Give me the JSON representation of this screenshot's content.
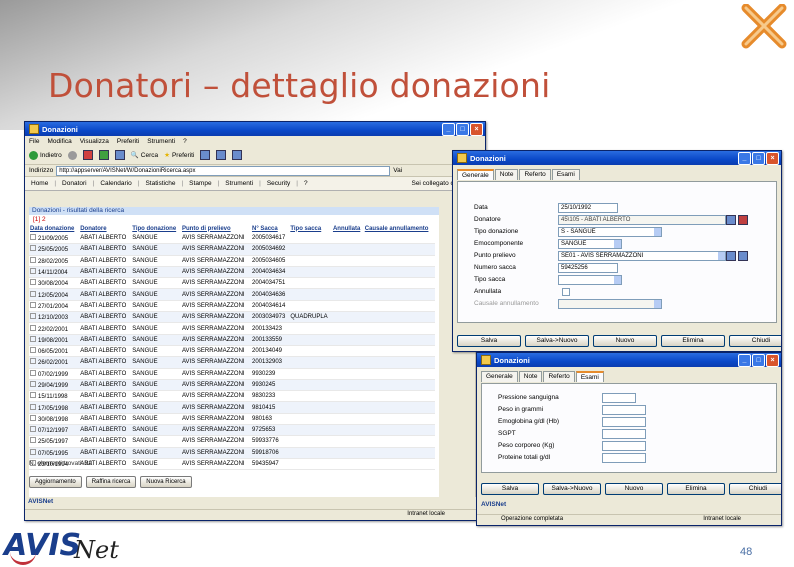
{
  "slide": {
    "title": "Donatori – dettaglio donazioni",
    "page_number": "48",
    "footer_logo_a": "AVIS",
    "footer_logo_net": "Net"
  },
  "browser": {
    "title": "Donazioni",
    "menu": [
      "File",
      "Modifica",
      "Visualizza",
      "Preferiti",
      "Strumenti",
      "?"
    ],
    "toolbar": [
      "Indietro",
      "Cerca",
      "Preferiti"
    ],
    "address_label": "Indirizzo",
    "address": "http://appserver/AVISNet/W/DonazioniRicerca.aspx",
    "go_label": "Vai",
    "app_tabs": [
      "Home",
      "Donatori",
      "Calendario",
      "Statistiche",
      "Stampe",
      "Strumenti",
      "Security",
      "?"
    ],
    "connected": "Sei collegato con",
    "search_title": "Donazioni - risultati della ricerca",
    "pager": "[1] 2",
    "columns": [
      "Data donazione",
      "Donatore",
      "Tipo donazione",
      "Punto di prelievo",
      "N° Sacca",
      "Tipo sacca",
      "Annullata",
      "Causale annullamento"
    ],
    "rows": [
      [
        "21/09/2005",
        "ABATI ALBERTO",
        "SANGUE",
        "AVIS SERRAMAZZONI",
        "2005034617",
        "",
        "",
        ""
      ],
      [
        "25/05/2005",
        "ABATI ALBERTO",
        "SANGUE",
        "AVIS SERRAMAZZONI",
        "2005034692",
        "",
        "",
        ""
      ],
      [
        "28/02/2005",
        "ABATI ALBERTO",
        "SANGUE",
        "AVIS SERRAMAZZONI",
        "2005034605",
        "",
        "",
        ""
      ],
      [
        "14/11/2004",
        "ABATI ALBERTO",
        "SANGUE",
        "AVIS SERRAMAZZONI",
        "2004034634",
        "",
        "",
        ""
      ],
      [
        "30/08/2004",
        "ABATI ALBERTO",
        "SANGUE",
        "AVIS SERRAMAZZONI",
        "2004034751",
        "",
        "",
        ""
      ],
      [
        "12/05/2004",
        "ABATI ALBERTO",
        "SANGUE",
        "AVIS SERRAMAZZONI",
        "2004034636",
        "",
        "",
        ""
      ],
      [
        "27/01/2004",
        "ABATI ALBERTO",
        "SANGUE",
        "AVIS SERRAMAZZONI",
        "2004034614",
        "",
        "",
        ""
      ],
      [
        "12/10/2003",
        "ABATI ALBERTO",
        "SANGUE",
        "AVIS SERRAMAZZONI",
        "2003034973",
        "QUADRUPLA",
        "",
        ""
      ],
      [
        "22/02/2001",
        "ABATI ALBERTO",
        "SANGUE",
        "AVIS SERRAMAZZONI",
        "200133423",
        "",
        "",
        ""
      ],
      [
        "19/08/2001",
        "ABATI ALBERTO",
        "SANGUE",
        "AVIS SERRAMAZZONI",
        "200133559",
        "",
        "",
        ""
      ],
      [
        "06/05/2001",
        "ABATI ALBERTO",
        "SANGUE",
        "AVIS SERRAMAZZONI",
        "200134049",
        "",
        "",
        ""
      ],
      [
        "26/02/2001",
        "ABATI ALBERTO",
        "SANGUE",
        "AVIS SERRAMAZZONI",
        "200132903",
        "",
        "",
        ""
      ],
      [
        "07/02/1999",
        "ABATI ALBERTO",
        "SANGUE",
        "AVIS SERRAMAZZONI",
        "9930239",
        "",
        "",
        ""
      ],
      [
        "29/04/1999",
        "ABATI ALBERTO",
        "SANGUE",
        "AVIS SERRAMAZZONI",
        "9930245",
        "",
        "",
        ""
      ],
      [
        "15/11/1998",
        "ABATI ALBERTO",
        "SANGUE",
        "AVIS SERRAMAZZONI",
        "9830233",
        "",
        "",
        ""
      ],
      [
        "17/05/1998",
        "ABATI ALBERTO",
        "SANGUE",
        "AVIS SERRAMAZZONI",
        "9810415",
        "",
        "",
        ""
      ],
      [
        "30/08/1998",
        "ABATI ALBERTO",
        "SANGUE",
        "AVIS SERRAMAZZONI",
        "980163",
        "",
        "",
        ""
      ],
      [
        "07/12/1997",
        "ABATI ALBERTO",
        "SANGUE",
        "AVIS SERRAMAZZONI",
        "9725653",
        "",
        "",
        ""
      ],
      [
        "25/05/1997",
        "ABATI ALBERTO",
        "SANGUE",
        "AVIS SERRAMAZZONI",
        "59933776",
        "",
        "",
        ""
      ],
      [
        "07/05/1995",
        "ABATI ALBERTO",
        "SANGUE",
        "AVIS SERRAMAZZONI",
        "59918706",
        "",
        "",
        ""
      ],
      [
        "23/10/1994",
        "ABATI ALBERTO",
        "SANGUE",
        "AVIS SERRAMAZZONI",
        "59435947",
        "",
        "",
        ""
      ]
    ],
    "found": "N. elementi trovati: 22",
    "buttons": [
      "Aggiornamento",
      "Raffina ricerca",
      "Nuova Ricerca"
    ],
    "app_label": "AVISNet",
    "status_zone": "Intranet locale"
  },
  "dialog1": {
    "title": "Donazioni",
    "tabs": [
      "Generale",
      "Note",
      "Referto",
      "Esami"
    ],
    "fields": [
      {
        "label": "Data",
        "value": "25/10/1992"
      },
      {
        "label": "Donatore",
        "value": "45\\105 - ABATI ALBERTO"
      },
      {
        "label": "Tipo donazione",
        "value": "S - SANGUE"
      },
      {
        "label": "Emocomponente",
        "value": "SANGUE"
      },
      {
        "label": "Punto prelievo",
        "value": "SE01 - AVIS SERRAMAZZONI"
      },
      {
        "label": "Numero sacca",
        "value": "59425256"
      },
      {
        "label": "Tipo sacca",
        "value": ""
      },
      {
        "label": "Annullata",
        "value": ""
      },
      {
        "label": "Causale annullamento",
        "value": ""
      }
    ],
    "buttons": [
      "Salva",
      "Salva->Nuovo",
      "Nuovo",
      "Elimina",
      "Chiudi"
    ]
  },
  "dialog2": {
    "title": "Donazioni",
    "tabs": [
      "Generale",
      "Note",
      "Referto",
      "Esami"
    ],
    "fields": [
      {
        "label": "Pressione sanguigna",
        "value": ""
      },
      {
        "label": "Peso in grammi",
        "value": ""
      },
      {
        "label": "Emoglobina g/dl (Hb)",
        "value": ""
      },
      {
        "label": "SGPT",
        "value": ""
      },
      {
        "label": "Peso corporeo (Kg)",
        "value": ""
      },
      {
        "label": "Proteine totali g/dl",
        "value": ""
      }
    ],
    "buttons": [
      "Salva",
      "Salva->Nuovo",
      "Nuovo",
      "Elimina",
      "Chiudi"
    ],
    "app_label": "AVISNet",
    "status": "Operazione completata",
    "status_zone": "Intranet locale"
  },
  "colors": {
    "title": "#c0503a",
    "xp_title": "#0a48c8",
    "link": "#1a3e8c"
  }
}
